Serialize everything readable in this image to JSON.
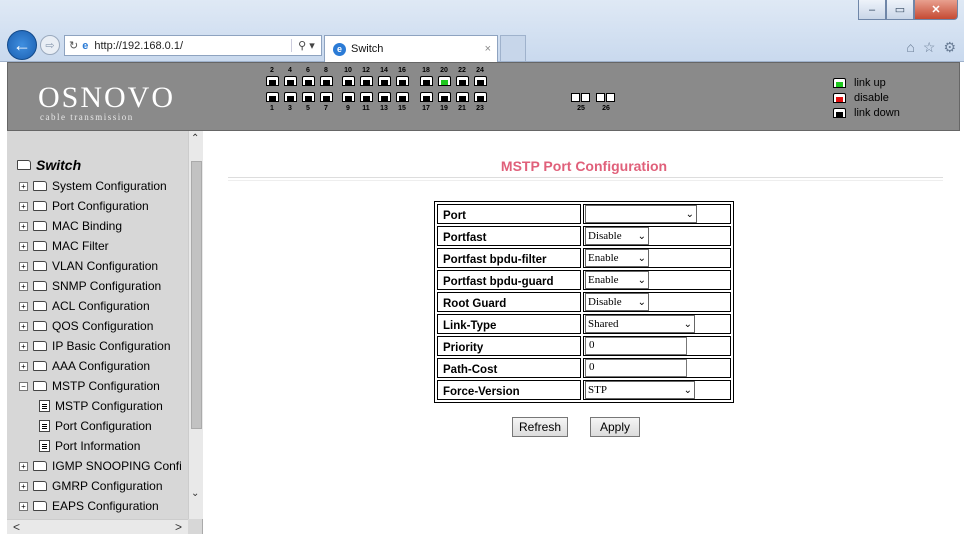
{
  "browser": {
    "url": "http://192.168.0.1/",
    "tab_title": "Switch",
    "window_buttons": {
      "minimize": "–",
      "restore": "▭",
      "close": "✕"
    },
    "back_icon": "←",
    "forward_icon": "⇨",
    "refresh_icon": "↻",
    "search_icon": "⚲ ▾",
    "tab_close": "×",
    "tool_icons": [
      "⌂",
      "☆",
      "⚙"
    ]
  },
  "banner": {
    "logo": "OSNOVO",
    "tagline": "cable transmission",
    "top_port_numbers": [
      "2",
      "4",
      "6",
      "8",
      "10",
      "12",
      "14",
      "16",
      "18",
      "20",
      "22",
      "24"
    ],
    "bottom_port_numbers": [
      "1",
      "3",
      "5",
      "7",
      "9",
      "11",
      "13",
      "15",
      "17",
      "19",
      "21",
      "23",
      "25",
      "26"
    ],
    "link_up_port": "20",
    "legend": [
      {
        "label": "link up",
        "color": "#1ec81e"
      },
      {
        "label": "disable",
        "color": "#e01010"
      },
      {
        "label": "link down",
        "color": "#000000"
      }
    ]
  },
  "sidebar": {
    "root": "Switch",
    "items": [
      {
        "label": "System Configuration",
        "type": "folder"
      },
      {
        "label": "Port Configuration",
        "type": "folder"
      },
      {
        "label": "MAC Binding",
        "type": "folder"
      },
      {
        "label": "MAC Filter",
        "type": "folder"
      },
      {
        "label": "VLAN Configuration",
        "type": "folder"
      },
      {
        "label": "SNMP Configuration",
        "type": "folder"
      },
      {
        "label": "ACL Configuration",
        "type": "folder"
      },
      {
        "label": "QOS Configuration",
        "type": "folder"
      },
      {
        "label": "IP Basic Configuration",
        "type": "folder"
      },
      {
        "label": "AAA Configuration",
        "type": "folder"
      },
      {
        "label": "MSTP Configuration",
        "type": "folder-open"
      },
      {
        "label": "MSTP Configuration",
        "type": "doc"
      },
      {
        "label": "Port Configuration",
        "type": "doc"
      },
      {
        "label": "Port Information",
        "type": "doc"
      },
      {
        "label": "IGMP SNOOPING Confi",
        "type": "folder"
      },
      {
        "label": "GMRP Configuration",
        "type": "folder"
      },
      {
        "label": "EAPS Configuration",
        "type": "folder"
      }
    ],
    "expander": "+",
    "collapser": "−",
    "scroll_up": "⌃",
    "scroll_down": "⌄",
    "scroll_left": "<",
    "scroll_right": ">"
  },
  "main": {
    "title": "MSTP Port Configuration",
    "fields": [
      {
        "label": "Port",
        "kind": "select",
        "value": ""
      },
      {
        "label": "Portfast",
        "kind": "select",
        "value": "Disable"
      },
      {
        "label": "Portfast bpdu-filter",
        "kind": "select",
        "value": "Enable"
      },
      {
        "label": "Portfast bpdu-guard",
        "kind": "select",
        "value": "Enable"
      },
      {
        "label": "Root Guard",
        "kind": "select",
        "value": "Disable"
      },
      {
        "label": "Link-Type",
        "kind": "select",
        "value": "Shared"
      },
      {
        "label": "Priority",
        "kind": "input",
        "value": "0"
      },
      {
        "label": "Path-Cost",
        "kind": "input",
        "value": "0"
      },
      {
        "label": "Force-Version",
        "kind": "select",
        "value": "STP"
      }
    ],
    "refresh_label": "Refresh",
    "apply_label": "Apply"
  }
}
